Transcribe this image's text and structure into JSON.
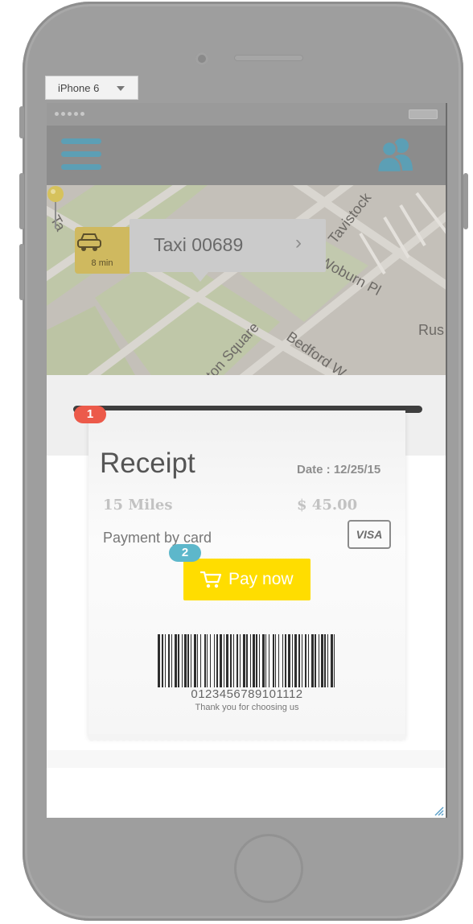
{
  "device_selector": {
    "value": "iPhone 6"
  },
  "map": {
    "streets": [
      "Tavistock",
      "Woburn Pl",
      "Bedford W",
      "ton Square",
      "Rus",
      "Ta"
    ],
    "taxi": {
      "eta": "8 min",
      "name": "Taxi 00689"
    }
  },
  "receipt": {
    "title": "Receipt",
    "date": "Date : 12/25/15",
    "distance": "15 Miles",
    "amount": "$ 45.00",
    "payment_method": "Payment by card",
    "card_brand": "VISA",
    "pay_button": "Pay now",
    "barcode_number": "0123456789101112",
    "thank_you": "Thank you for choosing us"
  },
  "markers": {
    "first": "1",
    "second": "2"
  },
  "colors": {
    "accent_blue": "#5c9fb5",
    "pay_yellow": "#ffdd00",
    "marker_red": "#ec5a4a",
    "marker_blue": "#5db7cb"
  }
}
